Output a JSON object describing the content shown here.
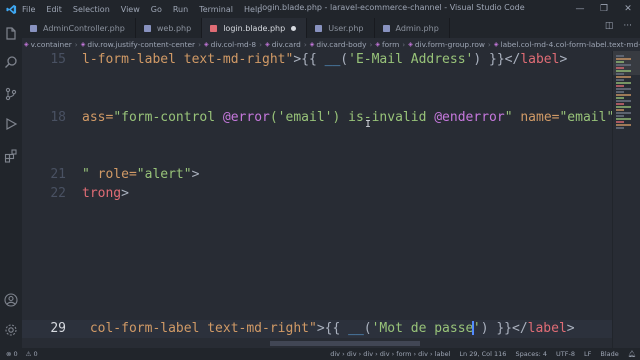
{
  "window": {
    "title": "login.blade.php - laravel-ecommerce-channel - Visual Studio Code",
    "menu": [
      "File",
      "Edit",
      "Selection",
      "View",
      "Go",
      "Run",
      "Terminal",
      "Help"
    ]
  },
  "tabs": [
    {
      "label": "AdminController.php",
      "active": false
    },
    {
      "label": "web.php",
      "active": false
    },
    {
      "label": "login.blade.php",
      "active": true,
      "modified": true
    },
    {
      "label": "User.php",
      "active": false
    },
    {
      "label": "Admin.php",
      "active": false
    }
  ],
  "breadcrumb": [
    "v.container",
    "div.row.justify-content-center",
    "div.col-md-8",
    "div.card",
    "div.card-body",
    "form",
    "div.form-group.row",
    "label.col-md-4.col-form-label.text-md-right"
  ],
  "editor": {
    "lines": [
      {
        "number": "15",
        "segments": [
          {
            "c": "t-attr",
            "t": "l-form-label text-md-right\""
          },
          {
            "c": "t-punc",
            "t": ">{{ "
          },
          {
            "c": "t-fn",
            "t": "__"
          },
          {
            "c": "t-punc",
            "t": "("
          },
          {
            "c": "t-str",
            "t": "'E-Mail Address'"
          },
          {
            "c": "t-punc",
            "t": ") }}</"
          },
          {
            "c": "t-tag",
            "t": "label"
          },
          {
            "c": "t-punc",
            "t": ">"
          }
        ]
      },
      {
        "number": "",
        "segments": []
      },
      {
        "number": "",
        "segments": []
      },
      {
        "number": "18",
        "segments": [
          {
            "c": "t-attr",
            "t": "ass="
          },
          {
            "c": "t-str",
            "t": "\"form-control "
          },
          {
            "c": "t-kw",
            "t": "@error"
          },
          {
            "c": "t-str",
            "t": "('email') is-invalid "
          },
          {
            "c": "t-kw",
            "t": "@enderror"
          },
          {
            "c": "t-str",
            "t": "\""
          },
          {
            "c": "t-attr",
            "t": " name="
          },
          {
            "c": "t-str",
            "t": "\"email\""
          }
        ]
      },
      {
        "number": "",
        "segments": []
      },
      {
        "number": "",
        "segments": []
      },
      {
        "number": "21",
        "segments": [
          {
            "c": "t-str",
            "t": "\""
          },
          {
            "c": "t-attr",
            "t": " role="
          },
          {
            "c": "t-str",
            "t": "\"alert\""
          },
          {
            "c": "t-punc",
            "t": ">"
          }
        ]
      },
      {
        "number": "22",
        "segments": [
          {
            "c": "t-tag",
            "t": "trong"
          },
          {
            "c": "t-punc",
            "t": ">"
          }
        ]
      },
      {
        "number": "",
        "segments": []
      },
      {
        "number": "",
        "segments": []
      },
      {
        "number": "",
        "segments": []
      },
      {
        "number": "",
        "segments": []
      },
      {
        "number": "",
        "segments": []
      },
      {
        "number": "",
        "segments": []
      },
      {
        "number": "29",
        "current": true,
        "segments": [
          {
            "c": "t-attr",
            "t": " col-form-label text-md-right\""
          },
          {
            "c": "t-punc",
            "t": ">{{ "
          },
          {
            "c": "t-fn",
            "t": "__"
          },
          {
            "c": "t-punc",
            "t": "("
          },
          {
            "c": "t-str",
            "t": "'Mot de passe"
          },
          {
            "c": "cursor",
            "t": ""
          },
          {
            "c": "t-str",
            "t": "'"
          },
          {
            "c": "t-punc",
            "t": ") }}</"
          },
          {
            "c": "t-tag",
            "t": "label"
          },
          {
            "c": "t-punc",
            "t": ">"
          }
        ]
      }
    ]
  },
  "statusbar": {
    "left": [
      "⊗ 0",
      "⚠ 0"
    ],
    "right": [
      "div",
      "div",
      "div",
      "div",
      "form",
      "div",
      "label",
      "Ln 29, Col 116",
      "Spaces: 4",
      "UTF-8",
      "LF",
      "Blade"
    ],
    "breadcrumb_path": "div › div › div › div › form › div › label"
  },
  "colors": {
    "editor_bg": "#282c34",
    "chrome_bg": "#21252b",
    "string": "#98c379",
    "attribute": "#d19a66",
    "keyword": "#c678dd",
    "tag": "#e06c75",
    "function": "#61afef",
    "vscode_blue": "#3ea6f0"
  },
  "icons": {
    "activity": [
      "files-icon",
      "search-icon",
      "source-control-icon",
      "run-debug-icon",
      "extensions-icon",
      "account-icon",
      "settings-gear-icon"
    ]
  }
}
